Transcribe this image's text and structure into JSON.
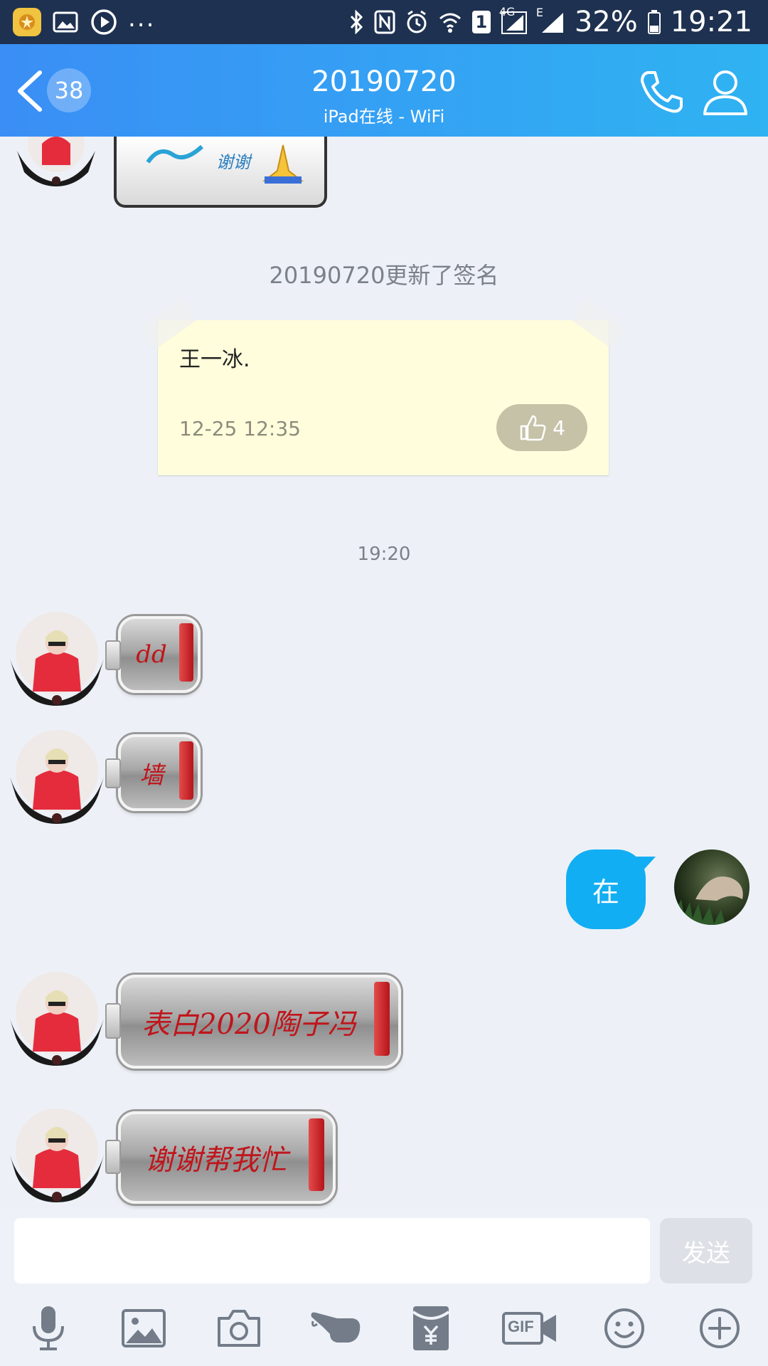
{
  "status_bar": {
    "battery": "32%",
    "time": "19:21",
    "signal_label_1": "1",
    "network_4g": "4G",
    "network_e": "E",
    "overflow": "..."
  },
  "header": {
    "unread_count": "38",
    "title": "20190720",
    "subtitle": "iPad在线 - WiFi",
    "gradient_start": "#3a8ef5",
    "gradient_end": "#2fb3f2"
  },
  "system_notice": "20190720更新了签名",
  "signature_note": {
    "text": "王一冰.",
    "date": "12-25 12:35",
    "likes": "4"
  },
  "time_separator": "19:20",
  "messages": [
    {
      "from": "other",
      "sticker_text": "dd"
    },
    {
      "from": "other",
      "sticker_text": "墙"
    },
    {
      "from": "me",
      "text": "在",
      "bubble_color": "#12aef3"
    },
    {
      "from": "other",
      "sticker_text": "表白2020陶子冯"
    },
    {
      "from": "other",
      "sticker_text": "谢谢帮我忙"
    }
  ],
  "top_sticker_text": "谢谢",
  "input": {
    "value": "",
    "send_label": "发送"
  },
  "toolbar": [
    "mic-icon",
    "image-icon",
    "camera-icon",
    "poke-icon",
    "red-packet-icon",
    "gif-icon",
    "emoji-icon",
    "plus-icon"
  ],
  "toolbar_gif_label": "GIF"
}
